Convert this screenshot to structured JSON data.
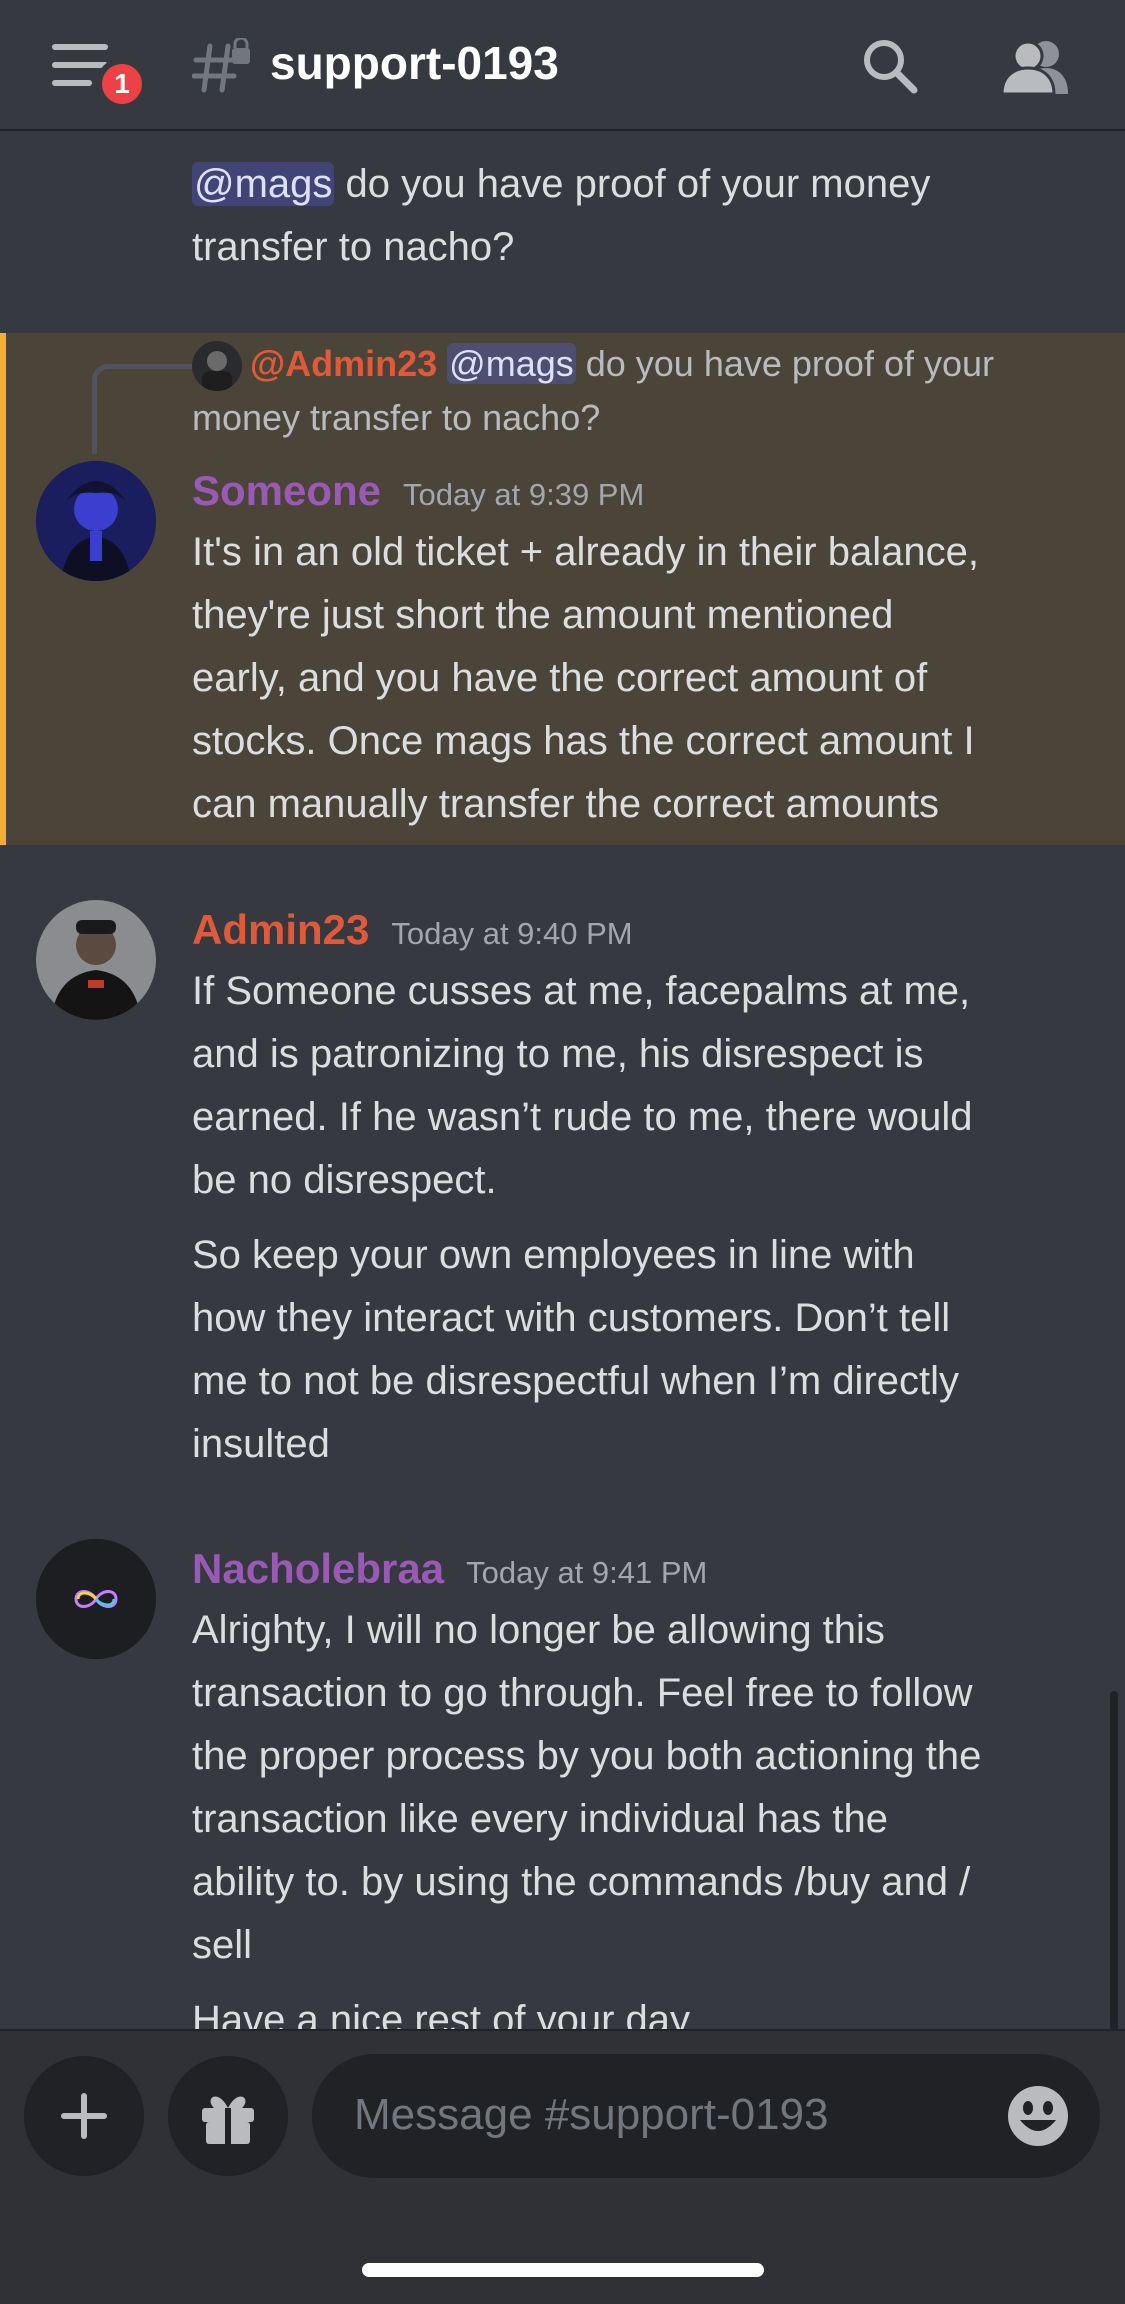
{
  "header": {
    "channel_name": "support-0193",
    "notification_count": "1"
  },
  "messages": {
    "top_partial": {
      "mention": "@mags",
      "text_line1": " do you have proof of your money",
      "text_line2": "transfer to nacho?"
    },
    "highlighted": {
      "reply_author": "@Admin23",
      "reply_mention": "@mags",
      "reply_text_line1": " do you have proof of your",
      "reply_text_line2": "money transfer to nacho?",
      "author": "Someone",
      "timestamp": "Today at 9:39 PM",
      "lines": [
        "It's in an old ticket + already in their balance,",
        "they're just short the amount mentioned",
        "early, and you have the correct amount of",
        "stocks. Once mags has the correct amount I",
        "can manually transfer the correct amounts"
      ]
    },
    "admin": {
      "author": "Admin23",
      "timestamp": "Today at 9:40 PM",
      "para1": [
        "If Someone cusses at me, facepalms at me,",
        "and is patronizing to me, his disrespect is",
        "earned. If he wasn’t rude to me, there would",
        "be no disrespect."
      ],
      "para2": [
        "So keep your own employees in line with",
        "how they interact with customers. Don’t tell",
        "me to not be disrespectful when I’m directly",
        "insulted"
      ]
    },
    "nacho": {
      "author": "Nacholebraa",
      "timestamp": "Today at 9:41 PM",
      "para1": [
        "Alrighty, I will no longer be allowing this",
        "transaction to go through. Feel free to follow",
        "the proper process by you both actioning the",
        "transaction like every individual has the",
        "ability to. by using the commands /buy and /",
        "sell"
      ],
      "para2": "Have a nice rest of your day"
    }
  },
  "composer": {
    "placeholder": "Message #support-0193"
  },
  "colors": {
    "someone": "#9b59b6",
    "admin": "#e05a3a",
    "nacho": "#9b59b6",
    "highlight_border": "#f0b132"
  },
  "icons": {
    "menu": "hamburger-icon",
    "channel": "locked-channel-icon",
    "search": "search-icon",
    "members": "members-icon",
    "add": "plus-icon",
    "gift": "gift-icon",
    "emoji": "emoji-icon"
  }
}
